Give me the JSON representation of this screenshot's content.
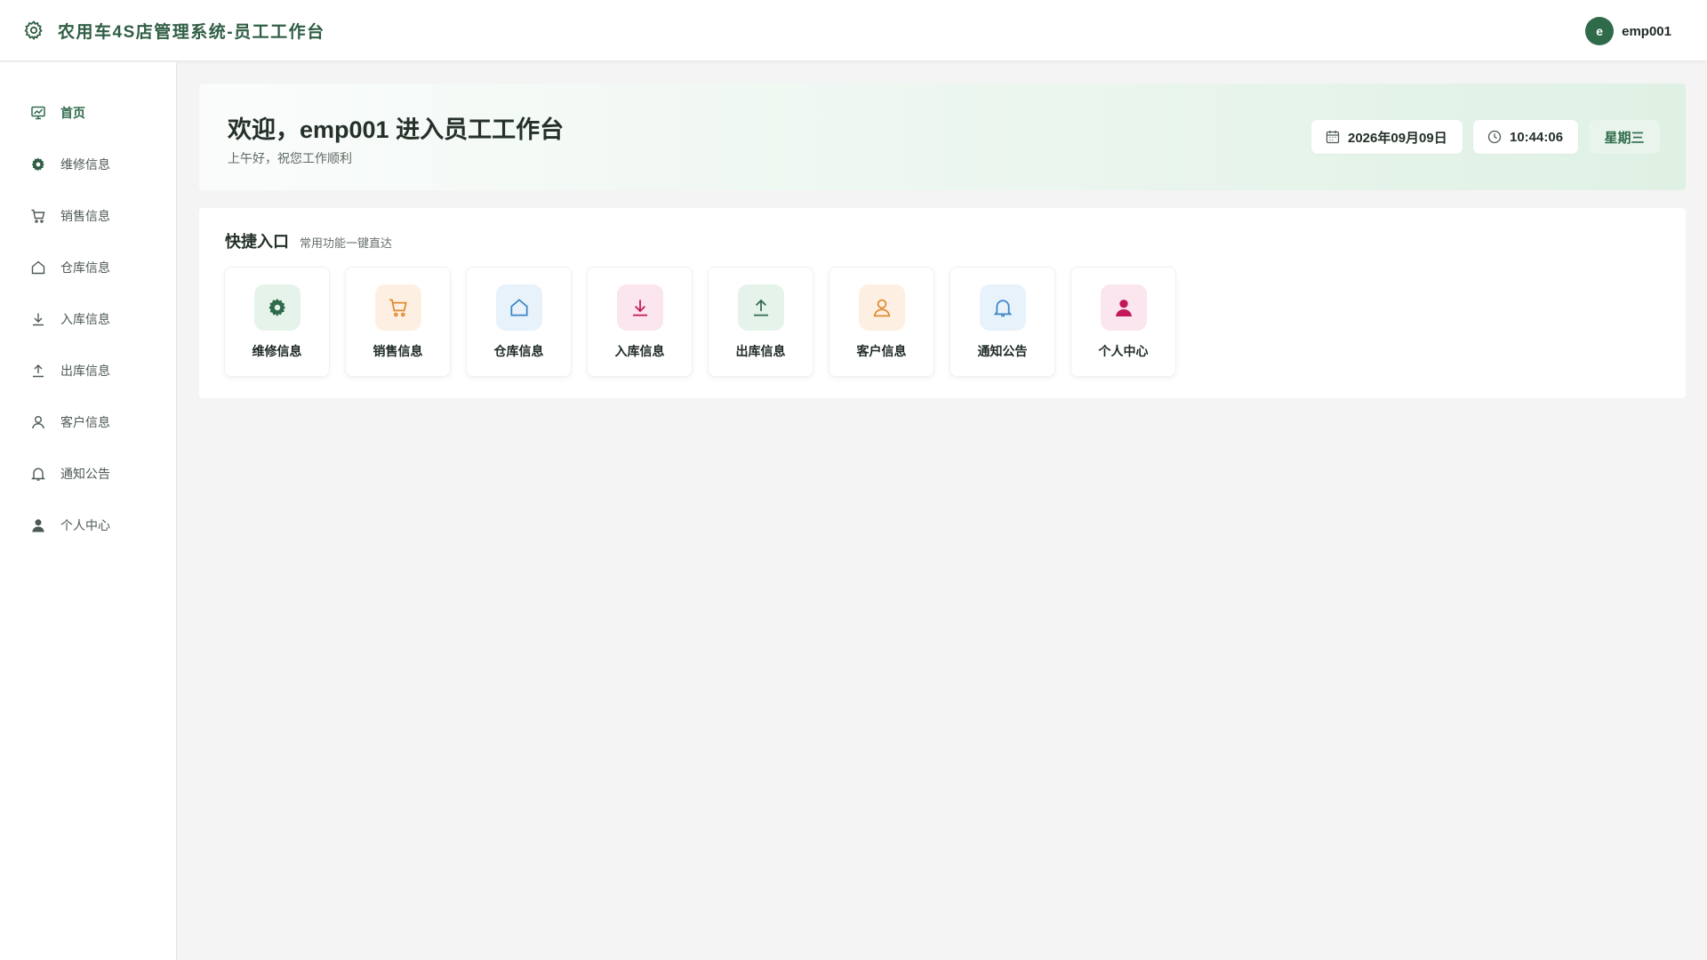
{
  "header": {
    "title": "农用车4S店管理系统-员工工作台",
    "user": {
      "avatar_letter": "e",
      "name": "emp001"
    }
  },
  "sidebar": {
    "items": [
      {
        "label": "首页",
        "icon": "dashboard-chart-icon",
        "active": true
      },
      {
        "label": "维修信息",
        "icon": "gear-icon"
      },
      {
        "label": "销售信息",
        "icon": "shopping-cart-icon"
      },
      {
        "label": "仓库信息",
        "icon": "house-icon"
      },
      {
        "label": "入库信息",
        "icon": "download-icon"
      },
      {
        "label": "出库信息",
        "icon": "upload-icon"
      },
      {
        "label": "客户信息",
        "icon": "user-outline-icon"
      },
      {
        "label": "通知公告",
        "icon": "bell-icon"
      },
      {
        "label": "个人中心",
        "icon": "user-filled-icon"
      }
    ]
  },
  "welcome": {
    "title": "欢迎，emp001 进入员工工作台",
    "subtitle": "上午好，祝您工作顺利",
    "date": "2026年09月09日",
    "time": "10:44:06",
    "weekday": "星期三"
  },
  "quick": {
    "title": "快捷入口",
    "subtitle": "常用功能一键直达",
    "cards": [
      {
        "label": "维修信息",
        "icon": "gear-icon",
        "bg": "#e6f3ea",
        "fg": "#2f6b4b"
      },
      {
        "label": "销售信息",
        "icon": "shopping-cart-icon",
        "bg": "#fdf0e3",
        "fg": "#e08a2e"
      },
      {
        "label": "仓库信息",
        "icon": "house-icon",
        "bg": "#e8f2fb",
        "fg": "#3a86c4"
      },
      {
        "label": "入库信息",
        "icon": "download-icon",
        "bg": "#fbe5ee",
        "fg": "#c2185b"
      },
      {
        "label": "出库信息",
        "icon": "upload-icon",
        "bg": "#e6f3ea",
        "fg": "#2f6b4b"
      },
      {
        "label": "客户信息",
        "icon": "user-outline-icon",
        "bg": "#fdf0e3",
        "fg": "#e08a2e"
      },
      {
        "label": "通知公告",
        "icon": "bell-icon",
        "bg": "#e8f2fb",
        "fg": "#3a86c4"
      },
      {
        "label": "个人中心",
        "icon": "user-filled-icon",
        "bg": "#fbe5ee",
        "fg": "#c2185b"
      }
    ]
  },
  "colors": {
    "brand": "#2f5e44",
    "accent": "#2f6b4b"
  }
}
